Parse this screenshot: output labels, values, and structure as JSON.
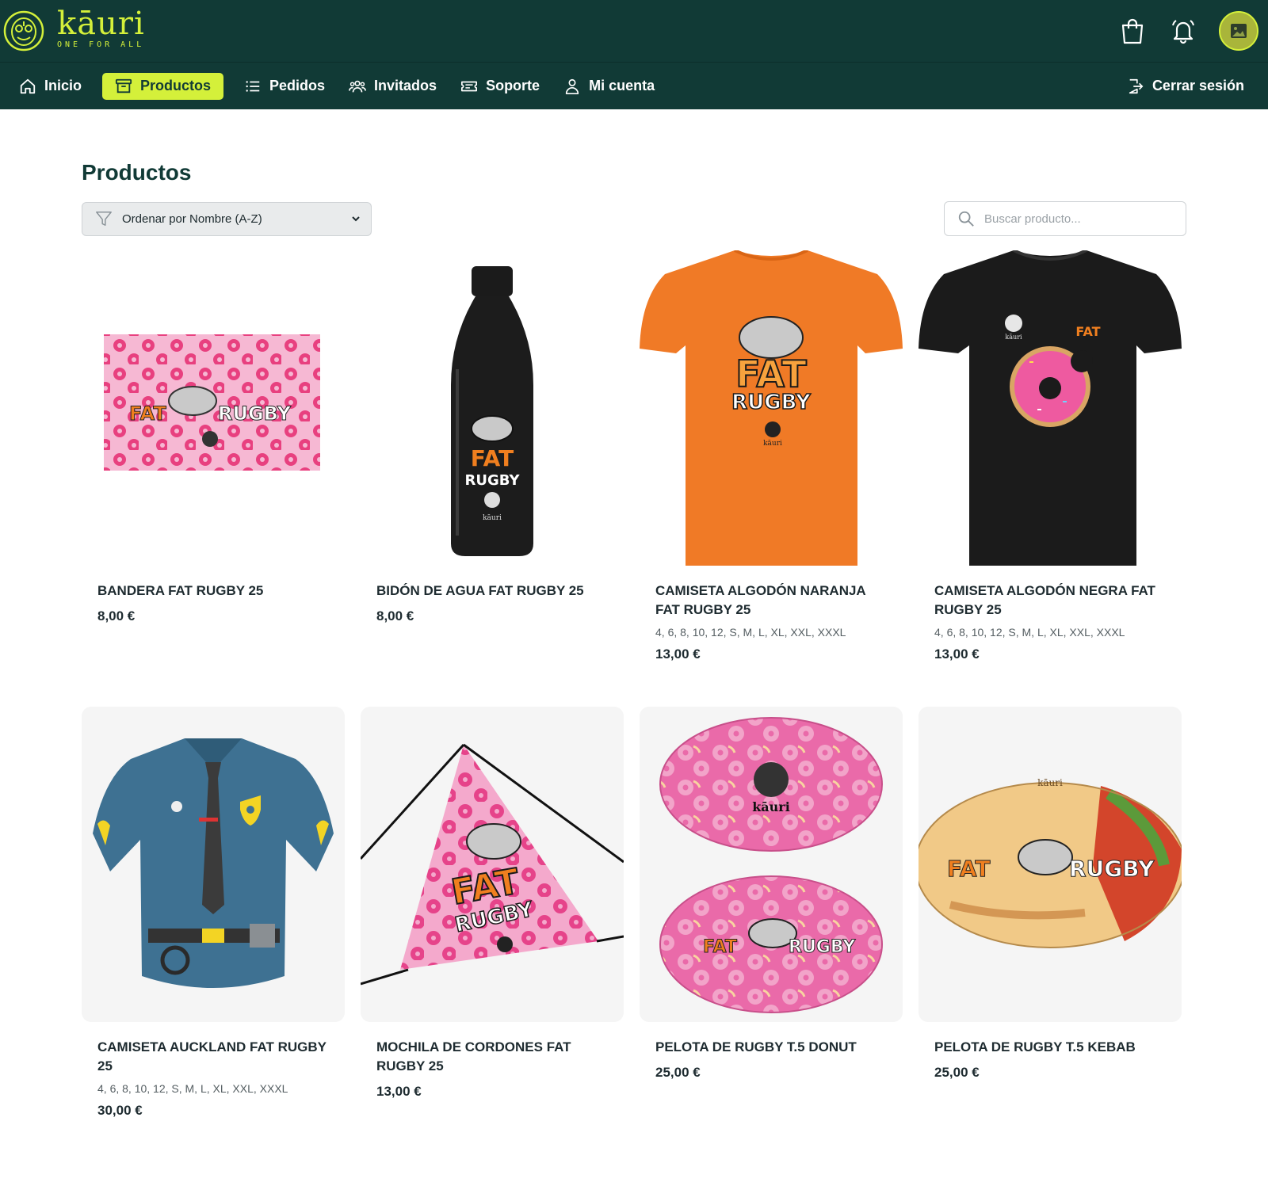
{
  "brand": {
    "name": "kāuri",
    "tagline": "ONE FOR ALL",
    "accent": "#d4f03a",
    "header_bg": "#113a36"
  },
  "header": {
    "icons": [
      "shopping-bag-icon",
      "bell-icon",
      "avatar-image-icon"
    ]
  },
  "nav": {
    "items": [
      {
        "label": "Inicio",
        "icon": "home-icon"
      },
      {
        "label": "Productos",
        "icon": "archive-box-icon",
        "active": true
      },
      {
        "label": "Pedidos",
        "icon": "list-icon"
      },
      {
        "label": "Invitados",
        "icon": "users-icon"
      },
      {
        "label": "Soporte",
        "icon": "ticket-icon"
      },
      {
        "label": "Mi cuenta",
        "icon": "user-icon"
      }
    ],
    "logout": {
      "label": "Cerrar sesión",
      "icon": "logout-icon"
    }
  },
  "page": {
    "title": "Productos"
  },
  "filters": {
    "sort_selected": "Ordenar por Nombre (A-Z)",
    "search_placeholder": "Buscar producto..."
  },
  "products": [
    {
      "name": "BANDERA FAT RUGBY 25",
      "sizes": "",
      "price": "8,00 €",
      "image": "pink donut flag"
    },
    {
      "name": "BIDÓN DE AGUA FAT RUGBY 25",
      "sizes": "",
      "price": "8,00 €",
      "image": "black water bottle"
    },
    {
      "name": "CAMISETA ALGODÓN NARANJA FAT RUGBY 25",
      "sizes": "4, 6, 8, 10, 12, S, M, L, XL, XXL, XXXL",
      "price": "13,00 €",
      "image": "orange t-shirt"
    },
    {
      "name": "CAMISETA ALGODÓN NEGRA FAT RUGBY 25",
      "sizes": "4, 6, 8, 10, 12, S, M, L, XL, XXL, XXXL",
      "price": "13,00 €",
      "image": "black t-shirt with donut"
    },
    {
      "name": "CAMISETA AUCKLAND FAT RUGBY 25",
      "sizes": "4, 6, 8, 10, 12, S, M, L, XL, XXL, XXXL",
      "price": "30,00 €",
      "image": "blue police jersey"
    },
    {
      "name": "MOCHILA DE CORDONES FAT RUGBY 25",
      "sizes": "",
      "price": "13,00 €",
      "image": "pink drawstring bag"
    },
    {
      "name": "PELOTA DE RUGBY T.5 DONUT",
      "sizes": "",
      "price": "25,00 €",
      "image": "two pink donut rugby balls"
    },
    {
      "name": "PELOTA DE RUGBY T.5 KEBAB",
      "sizes": "",
      "price": "25,00 €",
      "image": "kebab rugby ball"
    }
  ],
  "artwork": {
    "fat": "FAT",
    "rugby": "RUGBY",
    "brand_small": "kāuri"
  }
}
